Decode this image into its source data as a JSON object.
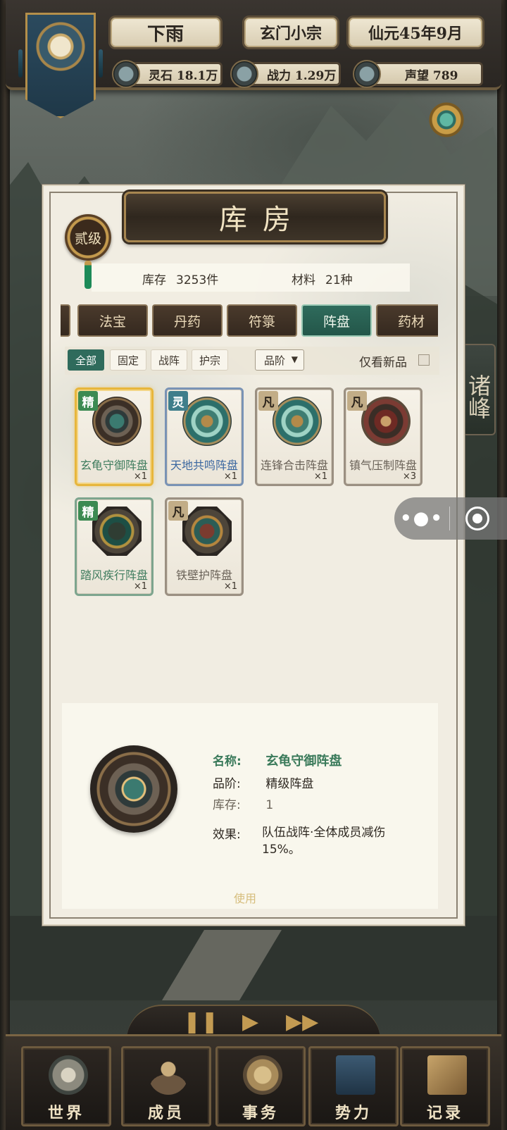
{
  "hud": {
    "weather": "下雨",
    "sect": "玄门小宗",
    "date": "仙元45年9月",
    "spirit_stones": "灵石 18.1万",
    "power": "战力 1.29万",
    "prestige": "声望 789"
  },
  "side_tab": "诸峰",
  "panel": {
    "title": "库房",
    "rank": "贰级",
    "stock_label": "库存",
    "stock_value": "3253件",
    "material_label": "材料",
    "material_value": "21种"
  },
  "categories": [
    {
      "label": "法宝",
      "active": false
    },
    {
      "label": "丹药",
      "active": false
    },
    {
      "label": "符箓",
      "active": false
    },
    {
      "label": "阵盘",
      "active": true
    },
    {
      "label": "药材",
      "active": false
    }
  ],
  "filters": {
    "chips": [
      "全部",
      "固定",
      "战阵",
      "护宗"
    ],
    "active_chip": "全部",
    "grade_select": "品阶",
    "new_only_label": "仅看新品",
    "new_only_checked": false
  },
  "items": [
    {
      "grade": "精",
      "name": "玄龟守御阵盘",
      "qty": "×1",
      "selected": true
    },
    {
      "grade": "灵",
      "name": "天地共鸣阵盘",
      "qty": "×1",
      "selected": false
    },
    {
      "grade": "凡",
      "name": "连锋合击阵盘",
      "qty": "×1",
      "selected": false
    },
    {
      "grade": "凡",
      "name": "镇气压制阵盘",
      "qty": "×3",
      "selected": false
    },
    {
      "grade": "精",
      "name": "踏风疾行阵盘",
      "qty": "×1",
      "selected": false
    },
    {
      "grade": "凡",
      "name": "铁壁护阵盘",
      "qty": "×1",
      "selected": false
    }
  ],
  "detail": {
    "name_key": "名称:",
    "name_val": "玄龟守御阵盘",
    "grade_key": "品阶:",
    "grade_val": "精级阵盘",
    "stock_key": "库存:",
    "stock_val": "1",
    "effect_key": "效果:",
    "effect_val": "队伍战阵·全体成员减伤15%。",
    "use_button": "使用"
  },
  "nav": [
    {
      "label": "世界"
    },
    {
      "label": "成员"
    },
    {
      "label": "事务"
    },
    {
      "label": "势力"
    },
    {
      "label": "记录"
    }
  ],
  "colors": {
    "accent_jade": "#2f6b5c",
    "grade_fine": "#3c8a52",
    "grade_spirit": "#3f7e8b",
    "gold": "#c39b52"
  }
}
